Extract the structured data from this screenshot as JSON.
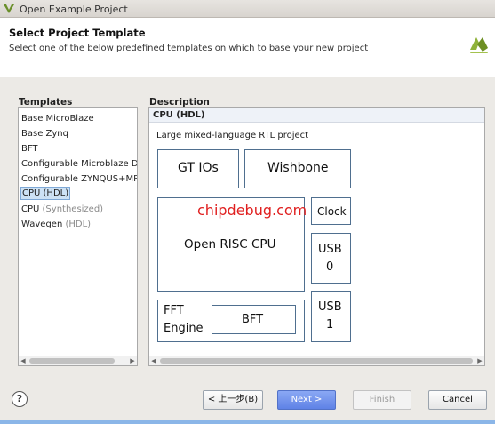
{
  "window": {
    "title": "Open Example Project"
  },
  "header": {
    "title": "Select Project Template",
    "subtitle": "Select one of the below predefined templates on which to base your new project"
  },
  "templates": {
    "label": "Templates",
    "items": [
      {
        "label": "Base MicroBlaze",
        "suffix": ""
      },
      {
        "label": "Base Zynq",
        "suffix": ""
      },
      {
        "label": "BFT",
        "suffix": ""
      },
      {
        "label": "Configurable Microblaze Design",
        "suffix": ""
      },
      {
        "label": "Configurable ZYNQUS+MPSOC D",
        "suffix": ""
      },
      {
        "label": "CPU",
        "suffix": "(HDL)",
        "selected": true
      },
      {
        "label": "CPU",
        "suffix": "(Synthesized)"
      },
      {
        "label": "Wavegen",
        "suffix": "(HDL)"
      }
    ]
  },
  "description": {
    "label": "Description",
    "heading": "CPU (HDL)",
    "text": "Large mixed-language RTL project",
    "diagram": {
      "gt_ios": "GT IOs",
      "wishbone": "Wishbone",
      "cpu": "Open RISC CPU",
      "clock": "Clock",
      "usb0_line1": "USB",
      "usb0_line2": "0",
      "usb1_line1": "USB",
      "usb1_line2": "1",
      "fft_line1": "FFT",
      "fft_line2": "Engine",
      "bft": "BFT",
      "watermark": "chipdebug.com"
    }
  },
  "buttons": {
    "help": "?",
    "back": "< 上一步(B)",
    "next": "Next >",
    "finish": "Finish",
    "cancel": "Cancel"
  },
  "colors": {
    "selection": "#cde2f5",
    "primary_button": "#5f82e6",
    "watermark": "#e02020"
  }
}
